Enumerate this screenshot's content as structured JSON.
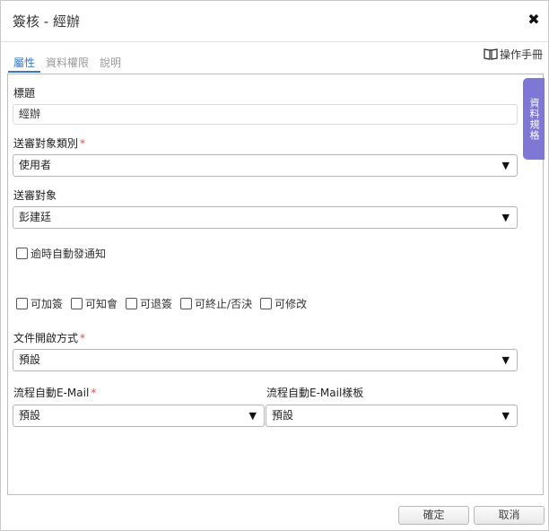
{
  "dialog": {
    "title": "簽核 - 經辦",
    "close_glyph": "✖",
    "manual_label": "操作手冊"
  },
  "tabs": [
    {
      "label": "屬性",
      "active": true
    },
    {
      "label": "資料權限",
      "active": false
    },
    {
      "label": "說明",
      "active": false
    }
  ],
  "side_tab": {
    "label": "資料規格"
  },
  "form": {
    "title_label": "標題",
    "title_value": "經辦",
    "target_type_label": "送審對象類別",
    "target_type_value": "使用者",
    "target_label": "送審對象",
    "target_value": "彭建廷",
    "overdue_notify_label": "逾時自動發通知",
    "required_mark": "*",
    "options": [
      {
        "label": "可加簽",
        "checked": false
      },
      {
        "label": "可知會",
        "checked": false
      },
      {
        "label": "可退簽",
        "checked": false
      },
      {
        "label": "可終止/否決",
        "checked": false
      },
      {
        "label": "可修改",
        "checked": false
      }
    ],
    "open_mode_label": "文件開啟方式",
    "open_mode_value": "預設",
    "email_label": "流程自動E-Mail",
    "email_value": "預設",
    "email_template_label": "流程自動E-Mail樣板",
    "email_template_value": "預設",
    "dropdown_arrow": "▼"
  },
  "footer": {
    "confirm_label": "確定",
    "cancel_label": "取消"
  },
  "colors": {
    "accent": "#3a78c6",
    "side_tab": "#7f77d6",
    "required": "#d9534f"
  }
}
